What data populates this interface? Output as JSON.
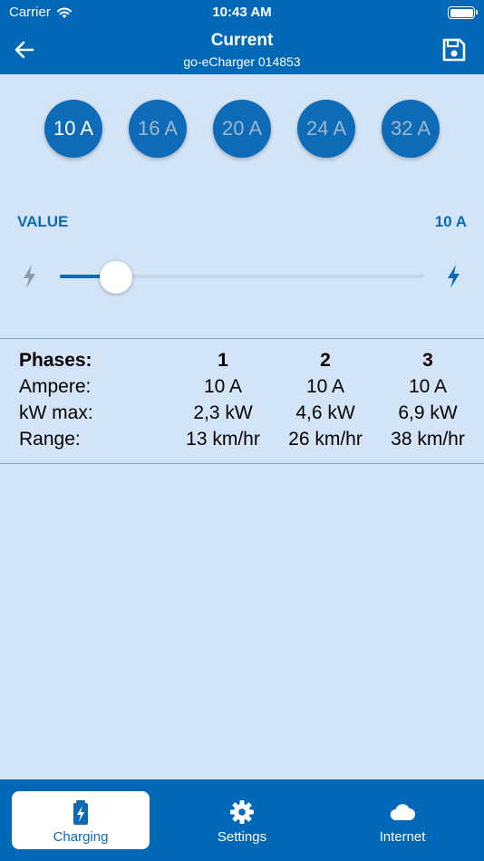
{
  "status_bar": {
    "carrier": "Carrier",
    "time": "10:43 AM"
  },
  "nav": {
    "title": "Current",
    "subtitle": "go-eCharger 014853"
  },
  "presets": [
    {
      "label": "10 A",
      "active": true
    },
    {
      "label": "16 A",
      "active": false
    },
    {
      "label": "20 A",
      "active": false
    },
    {
      "label": "24 A",
      "active": false
    },
    {
      "label": "32 A",
      "active": false
    }
  ],
  "value": {
    "label": "VALUE",
    "amount": "10 A"
  },
  "slider": {
    "min": 6,
    "max": 32,
    "current": 10
  },
  "table": {
    "headers": [
      "Phases:",
      "1",
      "2",
      "3"
    ],
    "rows": [
      [
        "Ampere:",
        "10 A",
        "10 A",
        "10 A"
      ],
      [
        "kW max:",
        "2,3 kW",
        "4,6 kW",
        "6,9 kW"
      ],
      [
        "Range:",
        "13 km/hr",
        "26 km/hr",
        "38 km/hr"
      ]
    ]
  },
  "tabs": [
    {
      "label": "Charging",
      "icon": "battery-charging-icon",
      "active": true
    },
    {
      "label": "Settings",
      "icon": "gear-icon",
      "active": false
    },
    {
      "label": "Internet",
      "icon": "cloud-icon",
      "active": false
    }
  ],
  "colors": {
    "primary": "#0169b8",
    "background": "#d3e4f6",
    "accent": "#0d6ab4",
    "inactive_text": "#9fb7cc"
  }
}
